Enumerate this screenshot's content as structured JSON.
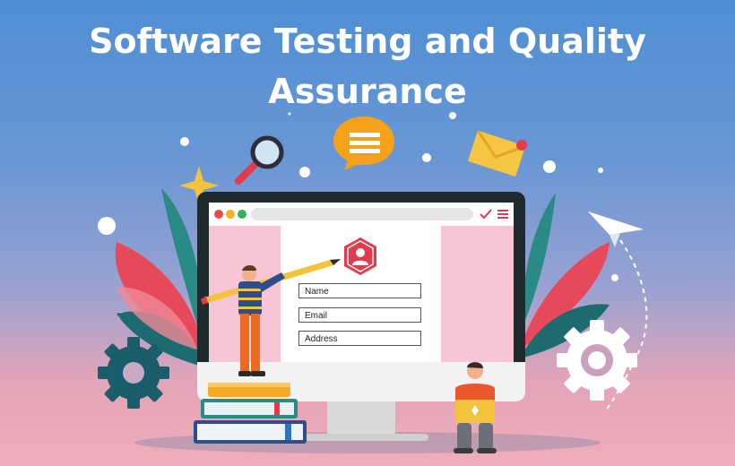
{
  "title": {
    "line1": "Software Testing and Quality",
    "line2": "Assurance"
  },
  "form": {
    "fields": [
      {
        "label": "Name"
      },
      {
        "label": "Email"
      },
      {
        "label": "Address"
      }
    ]
  },
  "browser": {
    "window_dots": [
      "#e94a4a",
      "#f0b429",
      "#2fb35b"
    ],
    "toolbar_icons": [
      "checkmark-icon",
      "menu-icon"
    ]
  },
  "colors": {
    "accent_red": "#e23b4e",
    "teal": "#1b5e6b",
    "pink": "#f7c5d3"
  },
  "icons": [
    "magnifier-icon",
    "chat-bubble-icon",
    "envelope-icon",
    "paper-plane-icon",
    "gear-icon",
    "sparkle-icon",
    "user-badge-icon"
  ]
}
